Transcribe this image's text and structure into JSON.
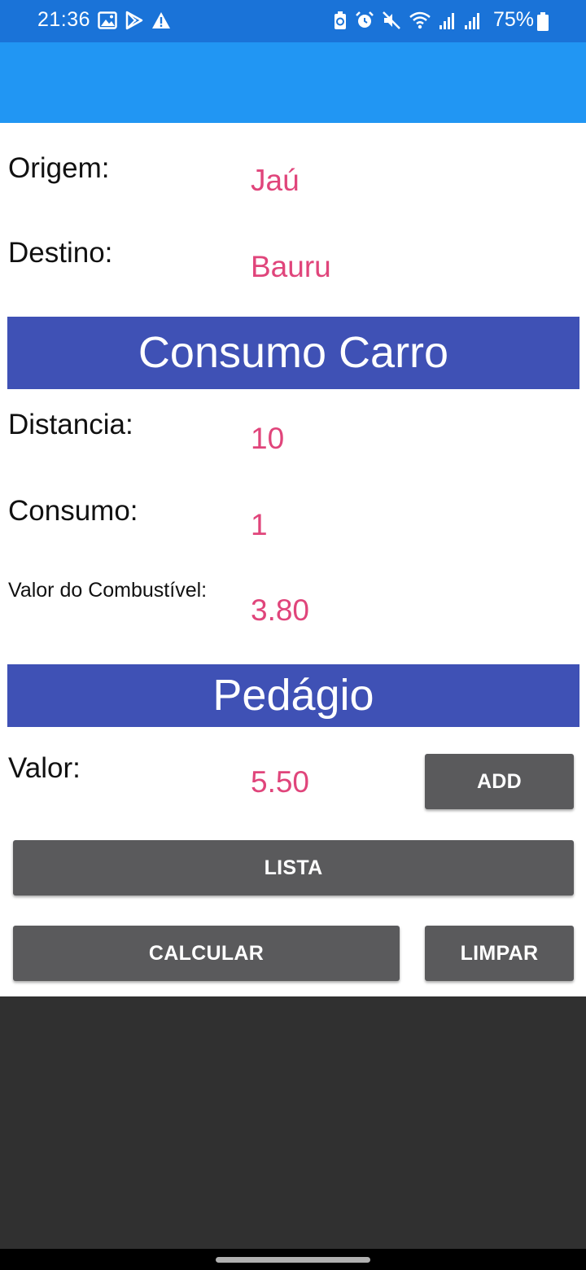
{
  "status_bar": {
    "time": "21:36",
    "battery_percent": "75%",
    "left_icons": [
      "image-icon",
      "play-store-icon",
      "warning-icon"
    ],
    "right_icons": [
      "recycle-battery-icon",
      "alarm-icon",
      "mute-icon",
      "wifi-icon",
      "signal-icon",
      "signal-icon",
      "battery-icon"
    ],
    "background": "#1a73d8"
  },
  "app_bar": {
    "background": "#2196f3"
  },
  "route": {
    "origin_label": "Origem:",
    "origin_value": "Jaú",
    "destination_label": "Destino:",
    "destination_value": "Bauru"
  },
  "consumption": {
    "header": "Consumo Carro",
    "distance_label": "Distancia:",
    "distance_value": "10",
    "consumption_label": "Consumo:",
    "consumption_value": "1",
    "fuel_price_label": "Valor do Combustível:",
    "fuel_price_value": "3.80"
  },
  "toll": {
    "header": "Pedágio",
    "value_label": "Valor:",
    "value": "5.50",
    "add_label": "ADD"
  },
  "actions": {
    "list_label": "LISTA",
    "calculate_label": "CALCULAR",
    "clear_label": "LIMPAR"
  },
  "colors": {
    "section_header": "#3f51b5",
    "value_text": "#e0457b",
    "button": "#5a5a5c"
  }
}
